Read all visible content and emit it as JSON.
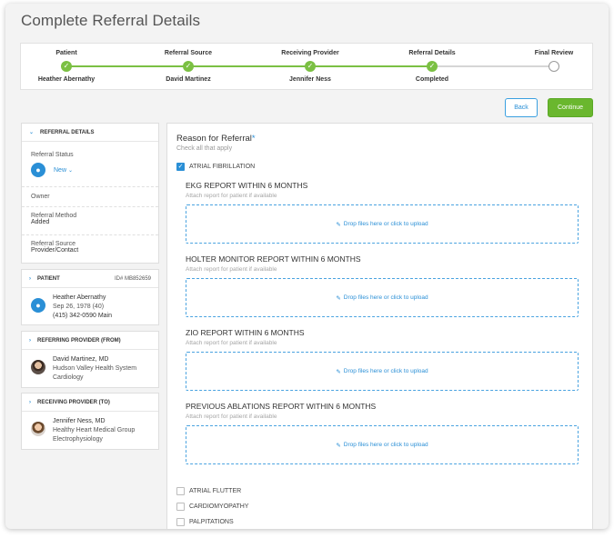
{
  "page": {
    "title": "Complete Referral Details"
  },
  "stepper": {
    "steps": [
      {
        "label": "Patient",
        "value": "Heather Abernathy",
        "done": true
      },
      {
        "label": "Referral Source",
        "value": "David Martinez",
        "done": true
      },
      {
        "label": "Receiving Provider",
        "value": "Jennifer Ness",
        "done": true
      },
      {
        "label": "Referral Details",
        "value": "Completed",
        "done": true
      },
      {
        "label": "Final Review",
        "value": "",
        "done": false
      }
    ]
  },
  "actions": {
    "back_label": "Back",
    "continue_label": "Continue"
  },
  "referral_details": {
    "header": "REFERRAL DETAILS",
    "status_label": "Referral Status",
    "status_value": "New",
    "owner_label": "Owner",
    "method_label": "Referral Method",
    "method_value": "Added",
    "source_label": "Referral Source",
    "source_value": "Provider/Contact"
  },
  "patient": {
    "header": "PATIENT",
    "id_text": "ID# MB852659",
    "name": "Heather Abernathy",
    "dob": "Sep 26, 1978 (40)",
    "phone": "(415) 342-0590 Main"
  },
  "referring_provider": {
    "header": "REFERRING PROVIDER (FROM)",
    "name": "David Martinez, MD",
    "org": "Hudson Valley Health System",
    "specialty": "Cardiology"
  },
  "receiving_provider": {
    "header": "RECEIVING PROVIDER (TO)",
    "name": "Jennifer Ness, MD",
    "org": "Healthy Heart Medical Group",
    "specialty": "Electrophysiology"
  },
  "reason": {
    "title": "Reason for Referral",
    "required_mark": "*",
    "hint": "Check all that apply",
    "selected_option": "ATRIAL FIBRILLATION",
    "reports": [
      {
        "title": "EKG REPORT WITHIN 6 MONTHS",
        "hint": "Attach report for patient if available",
        "upload": "Drop files here or click to upload"
      },
      {
        "title": "HOLTER MONITOR REPORT WITHIN 6 MONTHS",
        "hint": "Attach report for patient if available",
        "upload": "Drop files here or click to upload"
      },
      {
        "title": "ZIO REPORT WITHIN 6 MONTHS",
        "hint": "Attach report for patient if available",
        "upload": "Drop files here or click to upload"
      },
      {
        "title": "PREVIOUS ABLATIONS REPORT WITHIN 6 MONTHS",
        "hint": "Attach report for patient if available",
        "upload": "Drop files here or click to upload"
      }
    ],
    "other_options": [
      "ATRIAL FLUTTER",
      "CARDIOMYOPATHY",
      "PALPITATIONS"
    ]
  },
  "icons": {
    "check": "check-icon",
    "person": "person-icon",
    "paperclip": "paperclip-icon",
    "chevron": "chevron-down-icon"
  },
  "colors": {
    "accent": "#2a8fd6",
    "success": "#6ab72e"
  }
}
